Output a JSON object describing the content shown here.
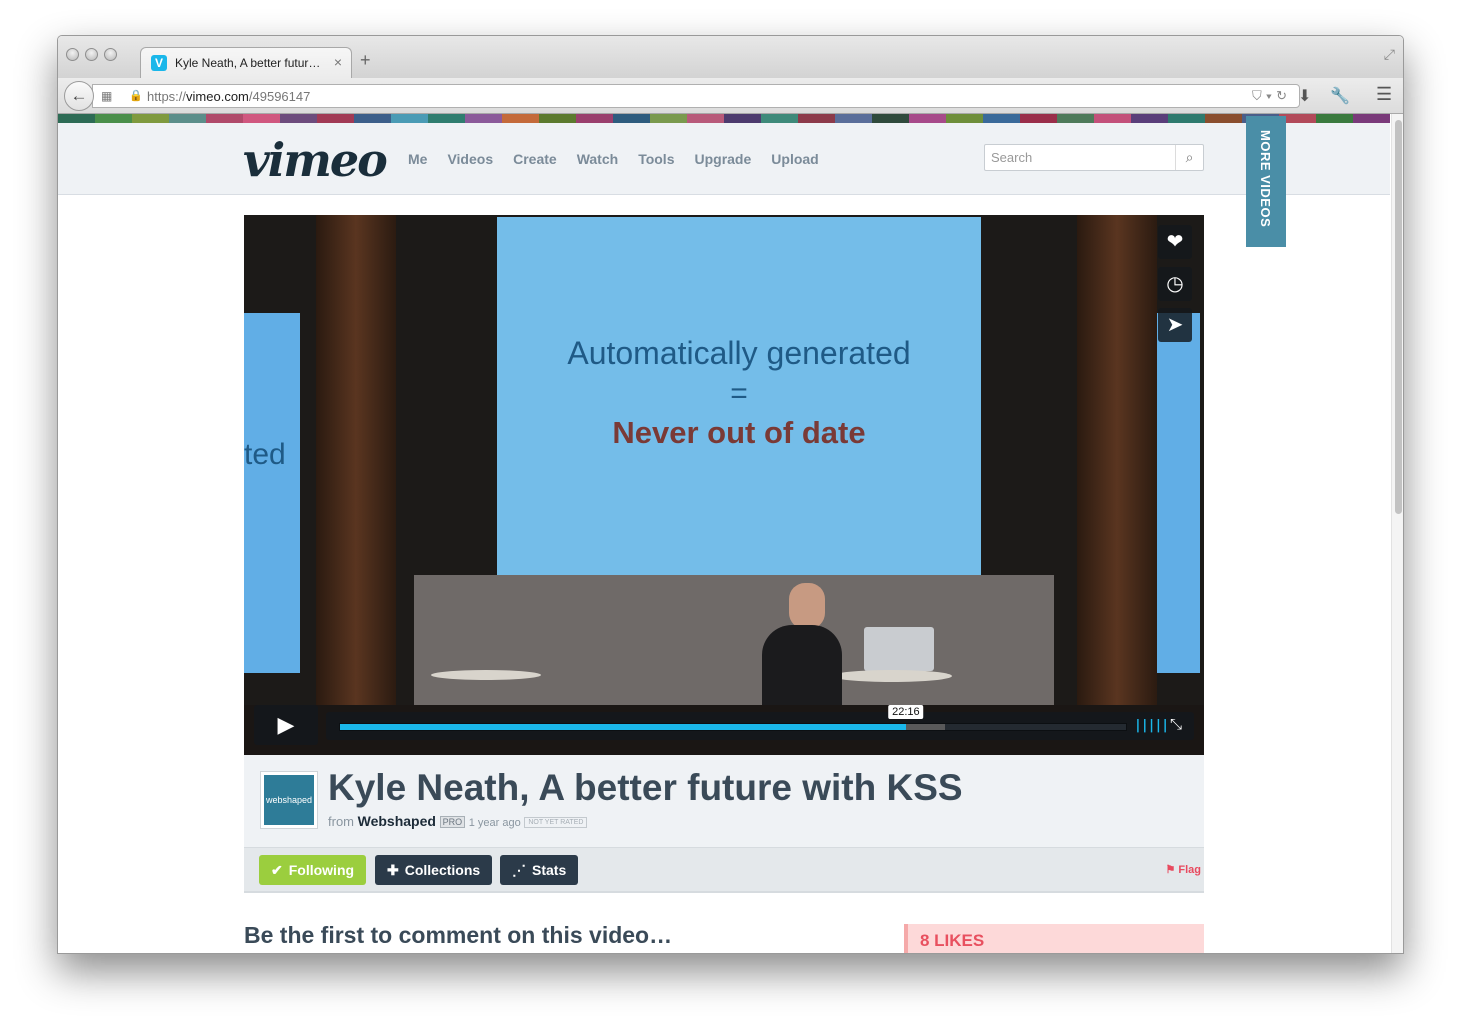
{
  "browser": {
    "tab_title": "Kyle Neath, A better futur…",
    "tab_favicon": "V",
    "tab_close": "×",
    "new_tab": "+",
    "url_scheme": "https://",
    "url_host": "vimeo.com",
    "url_path": "/49596147"
  },
  "site": {
    "logo": "vimeo",
    "nav": [
      "Me",
      "Videos",
      "Create",
      "Watch",
      "Tools",
      "Upgrade",
      "Upload"
    ],
    "search_placeholder": "Search",
    "more_videos": "MORE VIDEOS"
  },
  "player": {
    "slide_line1": "Automatically generated",
    "slide_line2": "=",
    "slide_line3": "Never out of date",
    "slide_left_text": "ted",
    "time": "22:16",
    "played_fraction": 0.72,
    "loaded_fraction": 0.77,
    "accent_color": "#1ab7ea"
  },
  "video": {
    "title": "Kyle Neath, A better future with KSS",
    "from_label": "from",
    "owner": "Webshaped",
    "owner_avatar_text": "webshaped",
    "pro_badge": "PRO",
    "age": "1 year ago",
    "rating": "NOT YET RATED"
  },
  "actions": {
    "following": "Following",
    "collections": "Collections",
    "stats": "Stats",
    "flag": "Flag"
  },
  "comments": {
    "heading": "Be the first to comment on this video…"
  },
  "likes": {
    "label": "8 LIKES"
  },
  "stripe_colors": [
    "#2d6b55",
    "#4a8f4a",
    "#7f9a3e",
    "#5b8e8a",
    "#b04a6a",
    "#d0577f",
    "#6d4c7d",
    "#a13a55",
    "#3c5f8a",
    "#4a9bb5",
    "#2f7d6f",
    "#8b5a9a",
    "#c46a3a",
    "#5c7a2e",
    "#9a3f6d",
    "#2e5c7e",
    "#7a9a4e",
    "#b85a7a",
    "#4d3b6e",
    "#3e8a7a",
    "#8c3a4a",
    "#5a6e9a",
    "#2f4a3c",
    "#a74a8a",
    "#6e8e3a",
    "#3a6a9a",
    "#9a2e4a",
    "#4e7a5a",
    "#c3507a",
    "#5a3e7a",
    "#2e7a6e",
    "#8a4e2e",
    "#4a5e8a",
    "#b24a5a",
    "#3a7a3e",
    "#7a3a7a"
  ]
}
